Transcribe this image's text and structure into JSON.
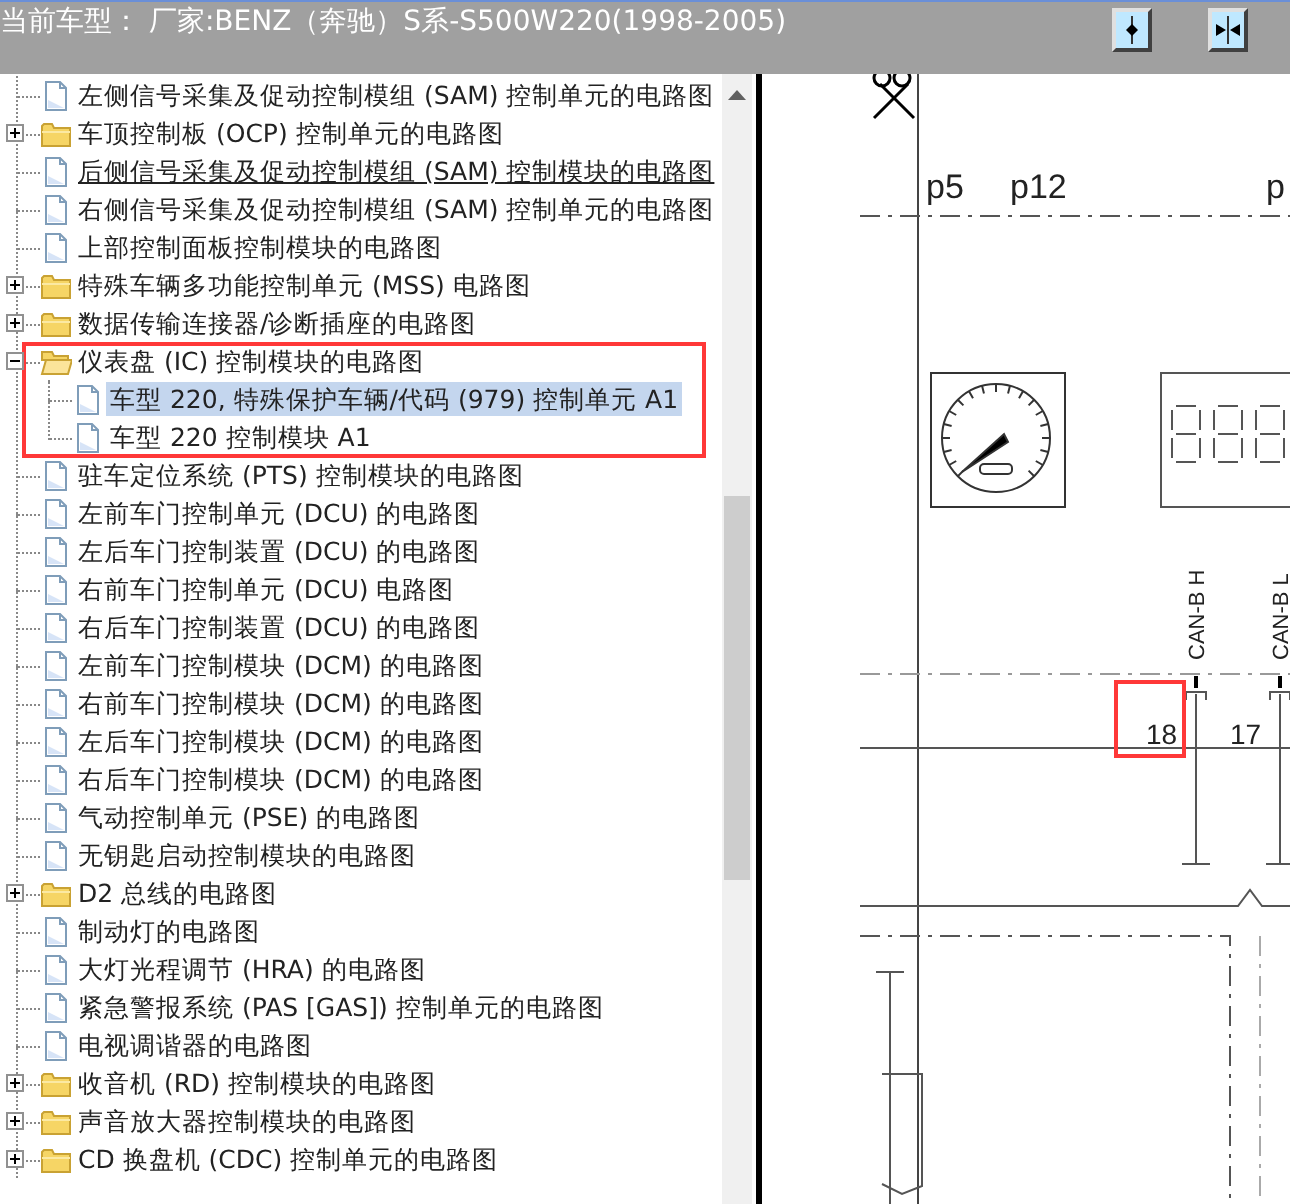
{
  "header": {
    "title": "当前车型： 厂家:BENZ（奔驰）S系-S500W220(1998-2005)"
  },
  "toolbar_buttons": [
    {
      "kind": "single"
    },
    {
      "kind": "double"
    }
  ],
  "tree": [
    {
      "label": "左侧信号采集及促动控制模组 (SAM) 控制单元的电路图",
      "kind": "page"
    },
    {
      "label": "车顶控制板 (OCP) 控制单元的电路图",
      "kind": "folder",
      "expanded": false
    },
    {
      "label": "后侧信号采集及促动控制模组 (SAM) 控制模块的电路图",
      "kind": "page",
      "hovered": true
    },
    {
      "label": "右侧信号采集及促动控制模组 (SAM) 控制单元的电路图",
      "kind": "page"
    },
    {
      "label": "上部控制面板控制模块的电路图",
      "kind": "page"
    },
    {
      "label": "特殊车辆多功能控制单元 (MSS) 电路图",
      "kind": "folder",
      "expanded": false
    },
    {
      "label": "数据传输连接器/诊断插座的电路图",
      "kind": "folder",
      "expanded": false
    },
    {
      "label": "仪表盘 (IC) 控制模块的电路图",
      "kind": "folder",
      "expanded": true,
      "outlined": true,
      "children": [
        {
          "label": "车型 220, 特殊保护车辆/代码 (979) 控制单元 A1",
          "kind": "page",
          "selected": true
        },
        {
          "label": "车型 220 控制模块 A1",
          "kind": "page",
          "selected": false
        }
      ]
    },
    {
      "label": "驻车定位系统 (PTS) 控制模块的电路图",
      "kind": "page"
    },
    {
      "label": "左前车门控制单元 (DCU) 的电路图",
      "kind": "page"
    },
    {
      "label": "左后车门控制装置 (DCU) 的电路图",
      "kind": "page"
    },
    {
      "label": "右前车门控制单元 (DCU) 电路图",
      "kind": "page"
    },
    {
      "label": "右后车门控制装置 (DCU) 的电路图",
      "kind": "page"
    },
    {
      "label": "左前车门控制模块 (DCM) 的电路图",
      "kind": "page"
    },
    {
      "label": "右前车门控制模块 (DCM) 的电路图",
      "kind": "page"
    },
    {
      "label": "左后车门控制模块 (DCM) 的电路图",
      "kind": "page"
    },
    {
      "label": "右后车门控制模块 (DCM) 的电路图",
      "kind": "page"
    },
    {
      "label": "气动控制单元 (PSE) 的电路图",
      "kind": "page"
    },
    {
      "label": "无钥匙启动控制模块的电路图",
      "kind": "page"
    },
    {
      "label": "D2 总线的电路图",
      "kind": "folder",
      "expanded": false
    },
    {
      "label": "制动灯的电路图",
      "kind": "page"
    },
    {
      "label": "大灯光程调节 (HRA) 的电路图",
      "kind": "page"
    },
    {
      "label": "紧急警报系统 (PAS [GAS]) 控制单元的电路图",
      "kind": "page"
    },
    {
      "label": "电视调谐器的电路图",
      "kind": "page"
    },
    {
      "label": "收音机 (RD) 控制模块的电路图",
      "kind": "folder",
      "expanded": false
    },
    {
      "label": "声音放大器控制模块的电路图",
      "kind": "folder",
      "expanded": false
    },
    {
      "label": "CD 换盘机 (CDC) 控制单元的电路图",
      "kind": "folder",
      "expanded": false
    }
  ],
  "diagram": {
    "labels": [
      "p5",
      "p12",
      "p"
    ],
    "signals": [
      "CAN-B H",
      "CAN-B L"
    ],
    "pins": [
      {
        "text": "18",
        "outlined": true
      },
      {
        "text": "17",
        "outlined": false
      }
    ]
  }
}
